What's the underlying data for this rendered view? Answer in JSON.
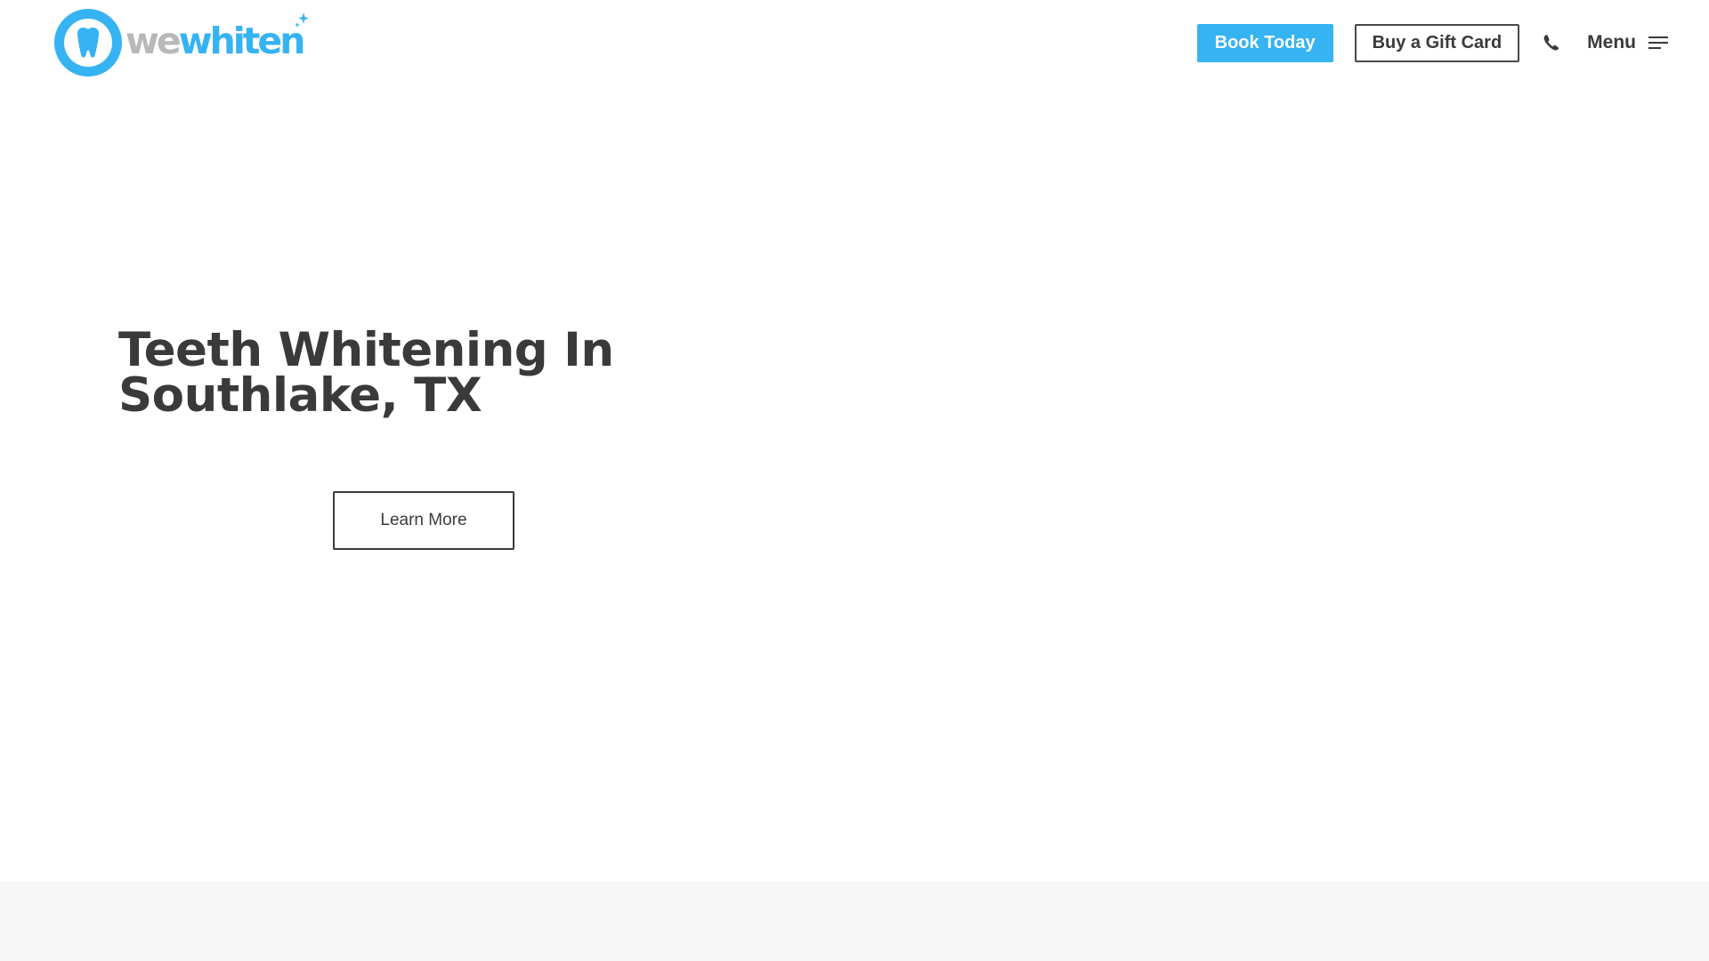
{
  "brand": {
    "logo_text_gray": "we",
    "logo_text_blue": "whiten",
    "primary_color": "#35b3f3",
    "gray_color": "#b8b8b8"
  },
  "nav": {
    "book_label": "Book Today",
    "gift_label": "Buy a Gift Card",
    "phone_icon": "phone-icon",
    "menu_label": "Menu",
    "menu_icon": "hamburger-icon"
  },
  "hero": {
    "title_line1": "Teeth Whitening In",
    "title_line2": "Southlake, TX",
    "cta_label": "Learn More"
  }
}
